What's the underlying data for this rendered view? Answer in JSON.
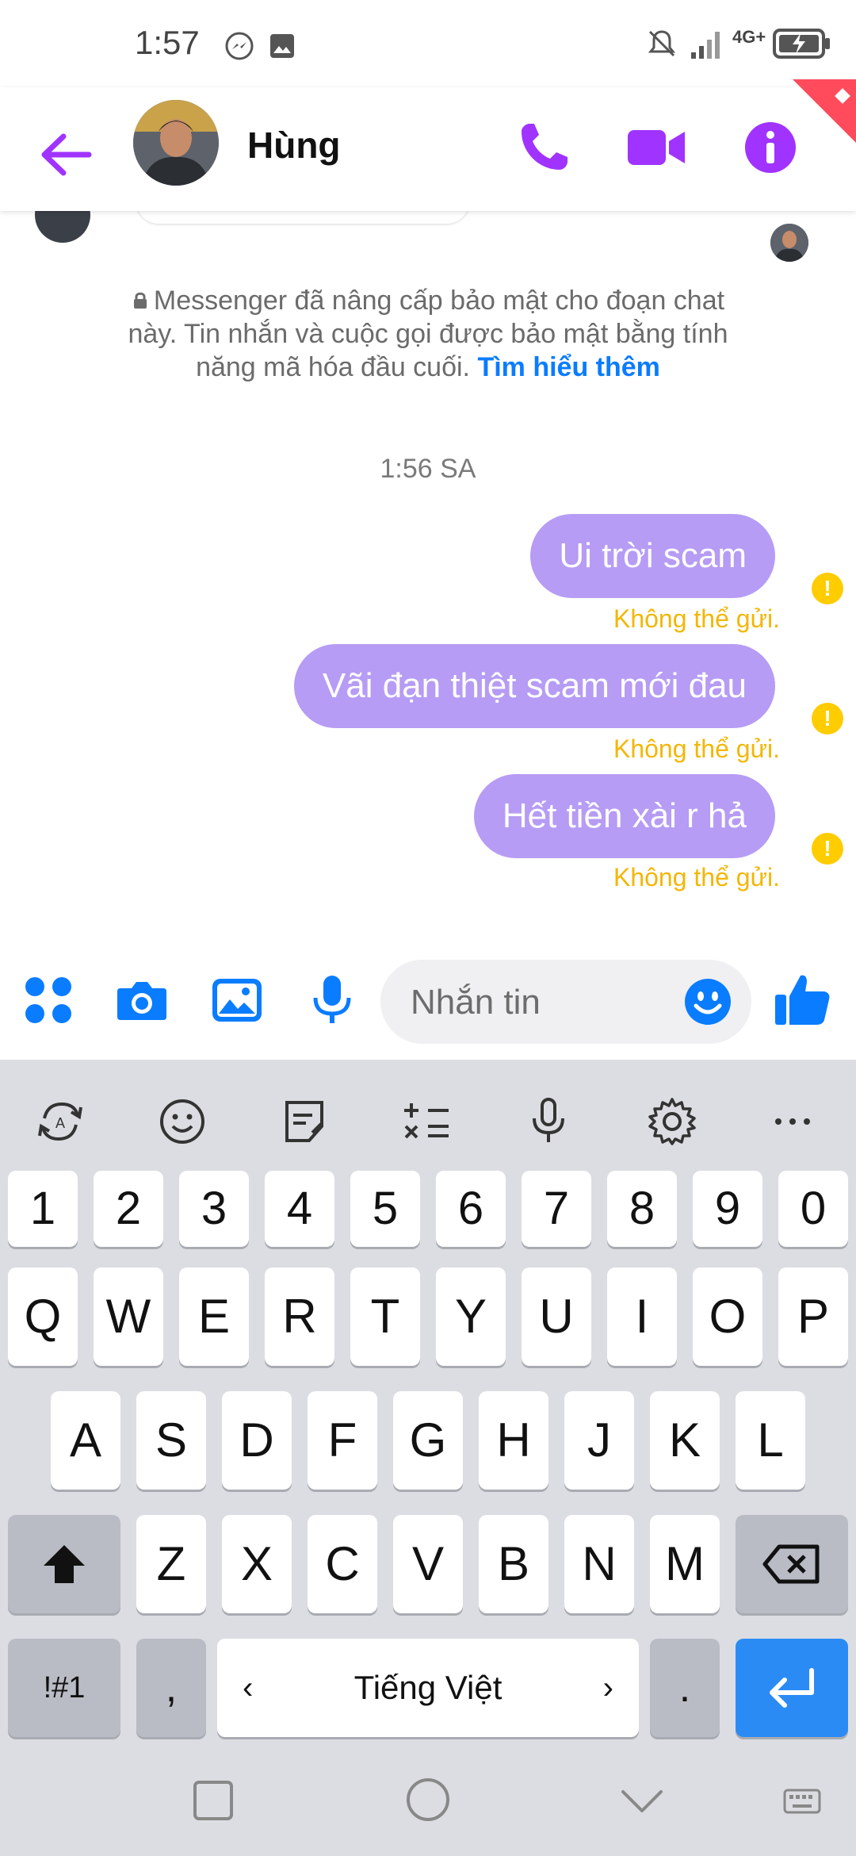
{
  "status_bar": {
    "time": "1:57",
    "network": "4G+"
  },
  "header": {
    "contact_name": "Hùng",
    "accent_color": "#a033ff"
  },
  "chat": {
    "security_note": "Messenger đã nâng cấp bảo mật cho đoạn chat này. Tin nhắn và cuộc gọi được bảo mật bằng tính năng mã hóa đầu cuối.",
    "learn_more": "Tìm hiểu thêm",
    "timestamp": "1:56 SA",
    "messages": [
      {
        "text": "Ui trời scam",
        "status": "Không thể gửi."
      },
      {
        "text": "Vãi đạn thiệt scam mới đau",
        "status": "Không thể gửi."
      },
      {
        "text": "Hết tiền xài r hả",
        "status": "Không thể gửi."
      }
    ],
    "bubble_color": "#b69cf4",
    "failed_color": "#f2b705"
  },
  "composer": {
    "placeholder": "Nhắn tin"
  },
  "keyboard": {
    "number_row": [
      "1",
      "2",
      "3",
      "4",
      "5",
      "6",
      "7",
      "8",
      "9",
      "0"
    ],
    "row1": [
      "Q",
      "W",
      "E",
      "R",
      "T",
      "Y",
      "U",
      "I",
      "O",
      "P"
    ],
    "row2": [
      "A",
      "S",
      "D",
      "F",
      "G",
      "H",
      "J",
      "K",
      "L"
    ],
    "row3": [
      "Z",
      "X",
      "C",
      "V",
      "B",
      "N",
      "M"
    ],
    "symbols_key": "!#1",
    "comma_key": ",",
    "language": "Tiếng Việt",
    "period_key": "."
  }
}
